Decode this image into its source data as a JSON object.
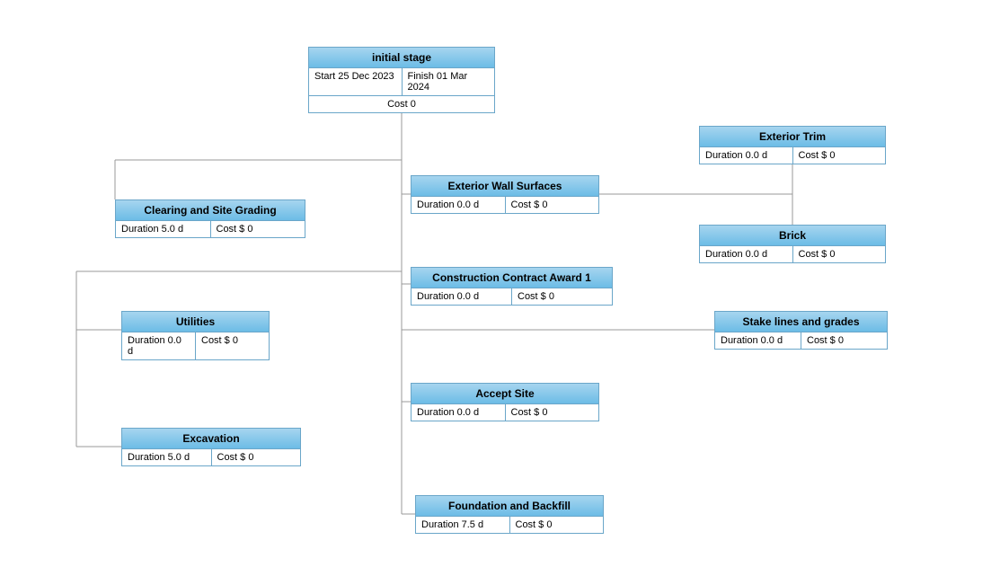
{
  "root": {
    "title": "initial stage",
    "start_label": "Start 25 Dec 2023",
    "finish_label": "Finish 01 Mar 2024",
    "cost_label": "Cost 0"
  },
  "nodes": {
    "exterior_wall": {
      "title": "Exterior Wall Surfaces",
      "duration": "Duration 0.0 d",
      "cost": "Cost   $ 0"
    },
    "exterior_trim": {
      "title": "Exterior Trim",
      "duration": "Duration 0.0 d",
      "cost": "Cost   $ 0"
    },
    "brick": {
      "title": "Brick",
      "duration": "Duration 0.0 d",
      "cost": "Cost   $ 0"
    },
    "clearing": {
      "title": "Clearing and Site Grading",
      "duration": "Duration 5.0 d",
      "cost": "Cost   $ 0"
    },
    "contract": {
      "title": "Construction Contract Award 1",
      "duration": "Duration 0.0 d",
      "cost": "Cost   $ 0"
    },
    "utilities": {
      "title": "Utilities",
      "duration": "Duration 0.0 d",
      "cost": "Cost   $ 0"
    },
    "stake": {
      "title": "Stake lines and grades",
      "duration": "Duration 0.0 d",
      "cost": "Cost   $ 0"
    },
    "accept": {
      "title": "Accept Site",
      "duration": "Duration 0.0 d",
      "cost": "Cost   $ 0"
    },
    "excavation": {
      "title": "Excavation",
      "duration": "Duration 5.0 d",
      "cost": "Cost   $ 0"
    },
    "foundation": {
      "title": "Foundation and Backfill",
      "duration": "Duration 7.5 d",
      "cost": "Cost   $ 0"
    }
  }
}
